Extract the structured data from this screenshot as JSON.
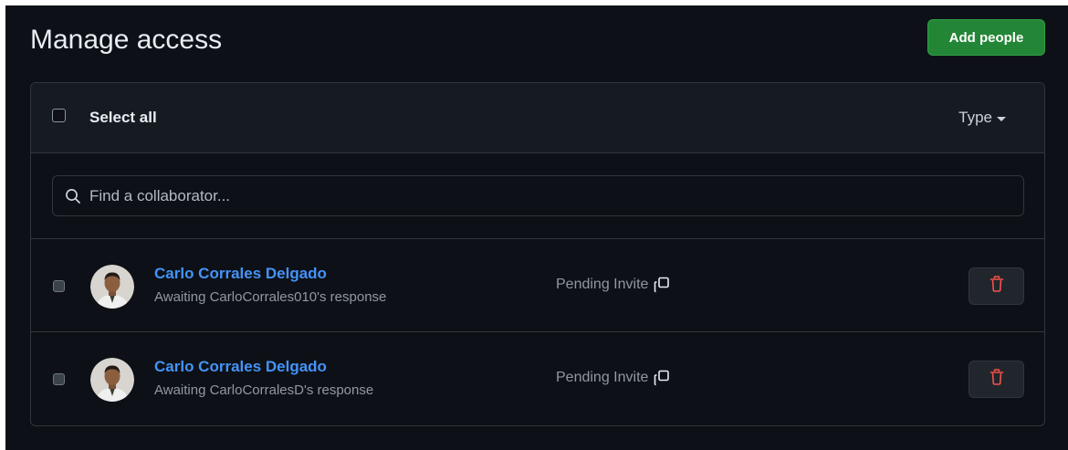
{
  "header": {
    "title": "Manage access",
    "add_button_label": "Add people"
  },
  "toolbar": {
    "select_all_label": "Select all",
    "type_filter_label": "Type"
  },
  "search": {
    "placeholder": "Find a collaborator...",
    "value": ""
  },
  "collaborators": [
    {
      "name": "Carlo Corrales Delgado",
      "subtitle": "Awaiting CarloCorrales010's response",
      "status": "Pending Invite",
      "selected": false
    },
    {
      "name": "Carlo Corrales Delgado",
      "subtitle": "Awaiting CarloCorralesD's response",
      "status": "Pending Invite",
      "selected": false
    }
  ],
  "icons": {
    "search": "search-icon",
    "copy": "copy-icon",
    "delete": "trash-icon",
    "dropdown": "caret-down-icon"
  },
  "colors": {
    "background": "#0d1117",
    "panel_header": "#161b22",
    "border": "#30363d",
    "primary_button": "#238636",
    "link": "#4493f8",
    "danger": "#f85149",
    "muted_text": "#9198a1"
  }
}
